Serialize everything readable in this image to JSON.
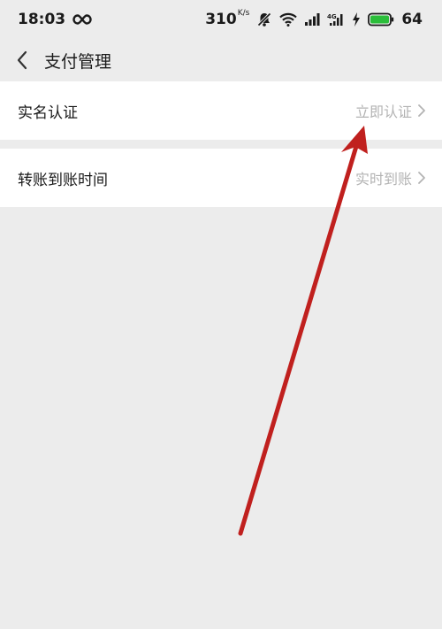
{
  "status_bar": {
    "time": "18:03",
    "loop_icon": "infinity-icon",
    "net_speed_value": "310",
    "net_speed_unit": "K/s",
    "battery_level": "64",
    "icons": [
      "mute-icon",
      "wifi-icon",
      "signal-icon",
      "signal-4g-icon",
      "charging-icon",
      "battery-icon"
    ],
    "battery_color": "#2bbd3a"
  },
  "header": {
    "back_icon": "chevron-left-icon",
    "title": "支付管理"
  },
  "settings": {
    "items": [
      {
        "label": "实名认证",
        "value": "立即认证"
      },
      {
        "label": "转账到账时间",
        "value": "实时到账"
      }
    ]
  },
  "annotation": {
    "type": "arrow",
    "color": "#c0201e"
  }
}
